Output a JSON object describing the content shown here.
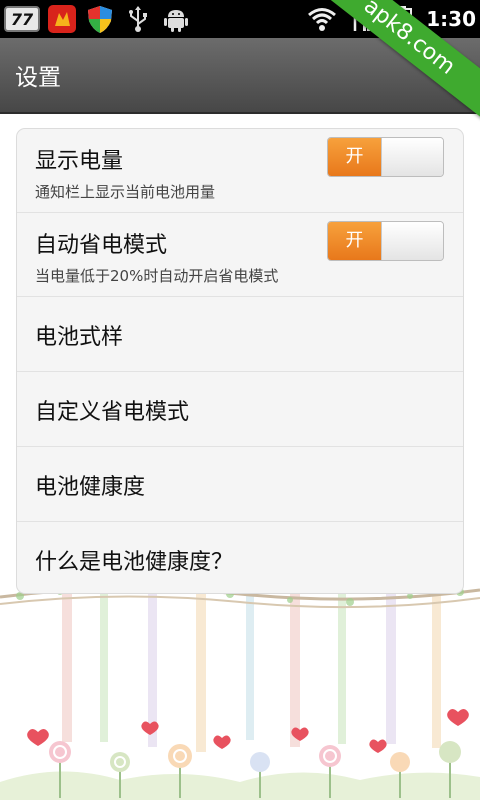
{
  "status_bar": {
    "notification_count": "77",
    "time": "1:30",
    "icons": [
      "battery-badge",
      "red-app-icon",
      "shield-app-icon",
      "usb-icon",
      "android-icon",
      "wifi-icon",
      "signal-icon",
      "battery-icon"
    ]
  },
  "watermark": "apk8.com",
  "title_bar": {
    "title": "设置"
  },
  "settings": {
    "items": [
      {
        "title": "显示电量",
        "subtitle": "通知栏上显示当前电池用量",
        "toggle_label": "开",
        "toggle_on": true
      },
      {
        "title": "自动省电模式",
        "subtitle": "当电量低于20%时自动开启省电模式",
        "toggle_label": "开",
        "toggle_on": true
      },
      {
        "title": "电池式样"
      },
      {
        "title": "自定义省电模式"
      },
      {
        "title": "电池健康度"
      },
      {
        "title": "什么是电池健康度？"
      }
    ]
  },
  "colors": {
    "toggle_on": "#f08a26",
    "title_bar": "#5a5a5a",
    "watermark": "#3faa2f"
  }
}
